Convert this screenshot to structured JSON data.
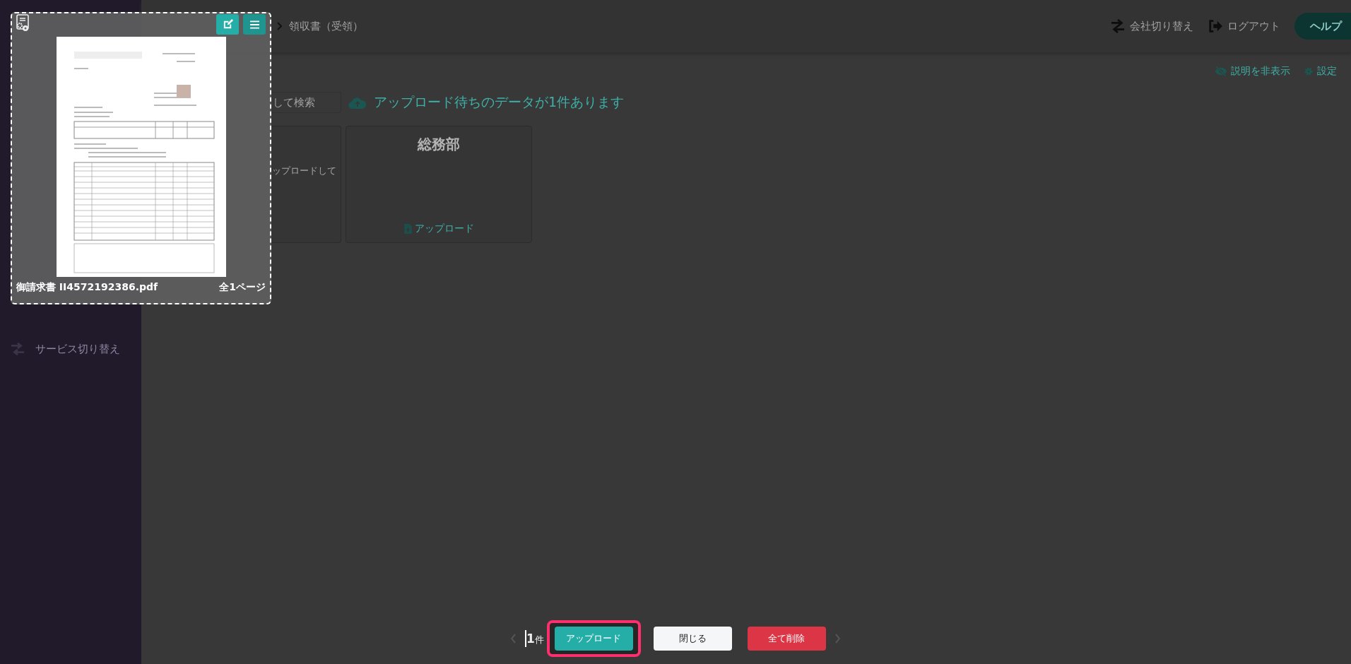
{
  "sidebar": {
    "items": [
      {
        "label": "サービス切り替え"
      }
    ]
  },
  "header": {
    "breadcrumb": "領収書（受領）",
    "company_switch": "会社切り替え",
    "logout": "ログアウト",
    "help": "ヘルプ"
  },
  "toolbar": {
    "hide_description": "説明を非表示",
    "settings": "設定"
  },
  "search": {
    "placeholder": "して検索"
  },
  "notice": "アップロード待ちのデータが1件あります",
  "departments": [
    {
      "kind": "partial",
      "text": "ップロードして"
    },
    {
      "kind": "full",
      "name": "総務部",
      "link": "アップロード"
    }
  ],
  "preview": {
    "file_name": "御請求書 II4572192386.pdf",
    "pages": "全1ページ"
  },
  "footer": {
    "count": "**1**件",
    "buttons": [
      {
        "label": "アップロード",
        "kind": "primary",
        "highlighted": true
      },
      {
        "label": "閉じる",
        "kind": "secondary",
        "highlighted": false
      },
      {
        "label": "全て削除",
        "kind": "danger",
        "highlighted": false
      }
    ]
  }
}
